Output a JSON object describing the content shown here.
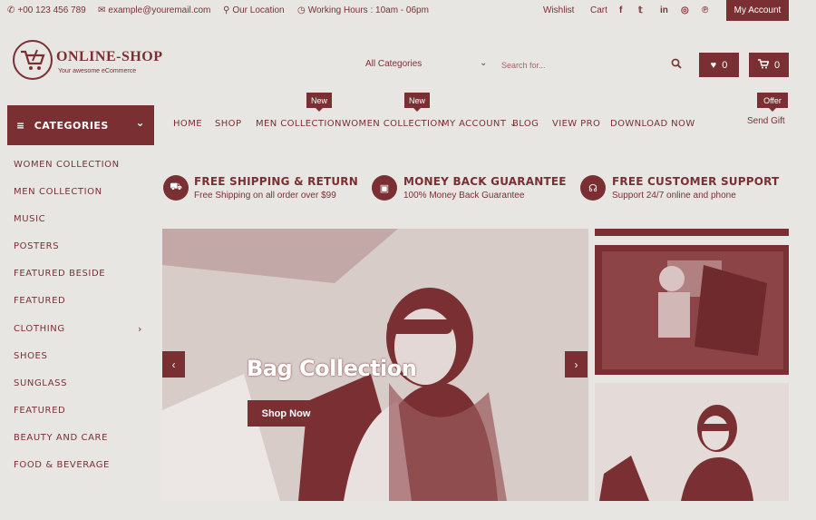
{
  "topbar": {
    "phone": "+00 123 456 789",
    "email": "example@youremail.com",
    "location": "Our Location",
    "hours": "Working Hours : 10am - 06pm",
    "wishlist": "Wishlist",
    "cart": "Cart",
    "social": [
      "facebook-icon",
      "twitter-icon",
      "linkedin-icon",
      "instagram-icon",
      "pinterest-icon"
    ],
    "my_account": "My Account"
  },
  "header": {
    "logo_title": "ONLINE-SHOP",
    "logo_tagline": "Your awesome eCommerce",
    "search_category": "All Categories",
    "search_placeholder": "Search for...",
    "wishlist_count": "0",
    "cart_count": "0"
  },
  "categories": {
    "title": "CATEGORIES",
    "items": [
      {
        "label": "Women Collection"
      },
      {
        "label": "Men Collection"
      },
      {
        "label": "Music"
      },
      {
        "label": "Posters"
      },
      {
        "label": "Featured Beside"
      },
      {
        "label": "Featured"
      },
      {
        "label": "Clothing",
        "has_submenu": true
      },
      {
        "label": "Shoes"
      },
      {
        "label": "Sunglass"
      },
      {
        "label": "Featured"
      },
      {
        "label": "Beauty and Care"
      },
      {
        "label": "Food & Beverage"
      }
    ]
  },
  "nav": {
    "items": [
      "Home",
      "Shop",
      "Men Collection",
      "Women Collection",
      "My Account",
      "Blog",
      "View Pro",
      "Download Now"
    ],
    "badge_men": "New",
    "badge_women": "New",
    "offer_badge": "Offer",
    "send_gift": "Send Gift"
  },
  "features": [
    {
      "title": "Free Shipping & Return",
      "sub": "Free Shipping on all order over $99"
    },
    {
      "title": "Money Back Guarantee",
      "sub": "100% Money Back Guarantee"
    },
    {
      "title": "Free Customer Support",
      "sub": "Support 24/7 online and phone"
    }
  ],
  "hero": {
    "title": "Bag Collection",
    "button": "Shop Now"
  },
  "colors": {
    "accent": "#7a3033",
    "background": "#e8e6e3"
  }
}
